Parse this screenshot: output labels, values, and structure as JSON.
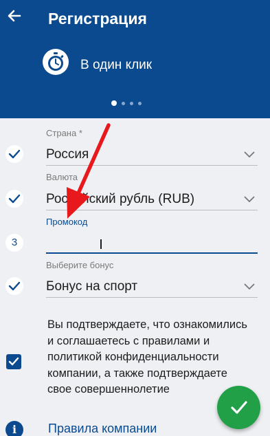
{
  "header": {
    "title": "Регистрация",
    "mode_label": "В один клик",
    "pager": {
      "pages": 4,
      "active": 1
    },
    "colors": {
      "background": "#0b4a8e",
      "text": "#ffffff"
    }
  },
  "form": {
    "country": {
      "label": "Страна *",
      "value": "Россия",
      "step_state": "completed"
    },
    "currency": {
      "label": "Валюта",
      "value": "Российский рубль (RUB)",
      "step_state": "completed"
    },
    "promo": {
      "label": "Промокод",
      "value": "",
      "step_number": "3"
    },
    "bonus": {
      "label": "Выберите бонус",
      "value": "Бонус на спорт",
      "step_state": "completed"
    }
  },
  "terms": {
    "checked": true,
    "text": "Вы подтверждаете, что ознакомились и соглашаетесь с правилами и политикой конфиденциальности компании, а также подтверждаете свое совершеннолетие"
  },
  "footer": {
    "info_icon_glyph": "i",
    "rules_link": "Правила компании"
  },
  "submit": {
    "icon": "check-icon",
    "color": "#22a047"
  },
  "annotation": {
    "type": "arrow",
    "color": "#e8191c",
    "points_to": "promo field"
  },
  "icons": {
    "back": "arrow-left-icon",
    "mode": "stopwatch-icon",
    "completed_step": "check-icon",
    "dropdown": "chevron-down-icon",
    "info": "info-icon"
  }
}
